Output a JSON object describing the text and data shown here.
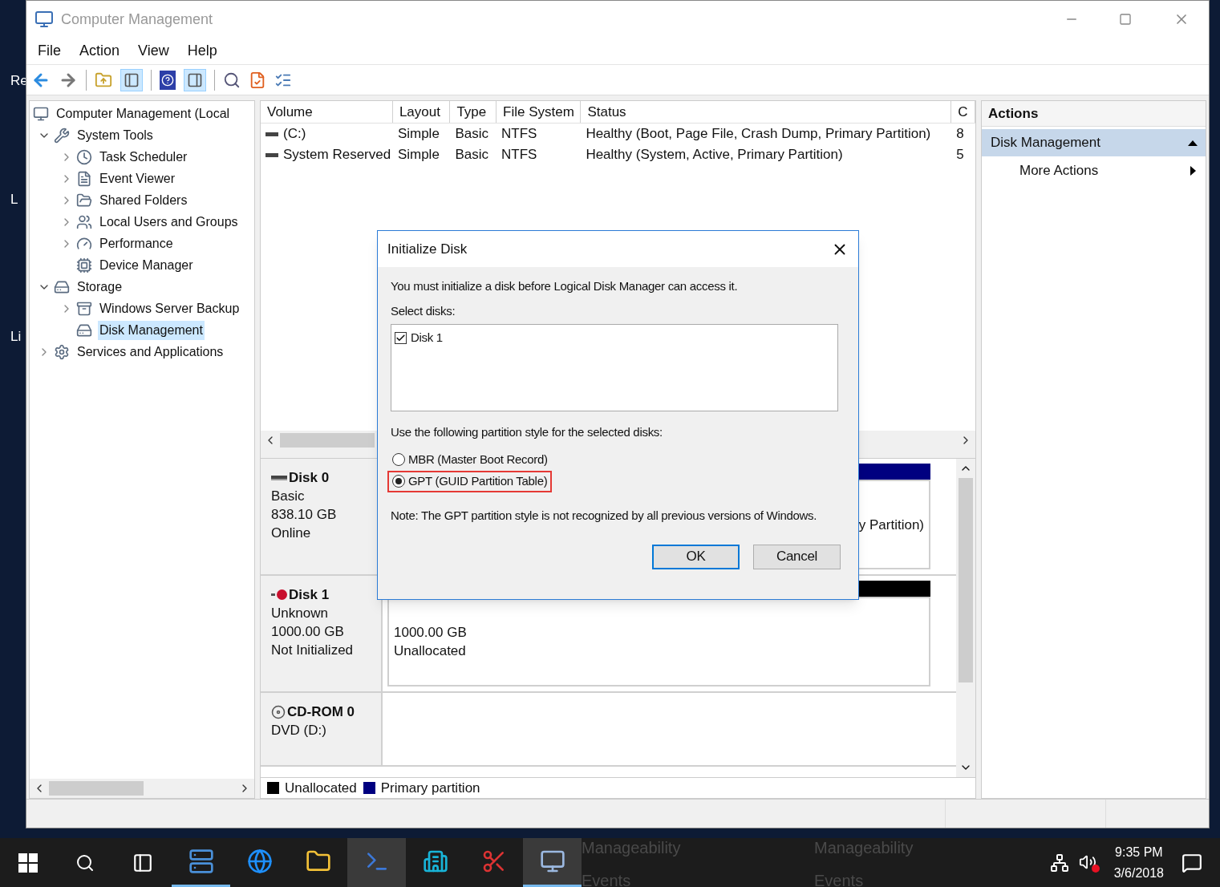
{
  "desktop_fragments": [
    "Re",
    "L",
    "Li"
  ],
  "window": {
    "title": "Computer Management"
  },
  "menu": [
    "File",
    "Action",
    "View",
    "Help"
  ],
  "tree": [
    {
      "label": "Computer Management (Local",
      "selected": false,
      "children": [
        {
          "label": "System Tools",
          "expanded": true,
          "selected": false,
          "children": [
            {
              "label": "Task Scheduler",
              "expanded": false,
              "selected": false
            },
            {
              "label": "Event Viewer",
              "expanded": false,
              "selected": false
            },
            {
              "label": "Shared Folders",
              "expanded": false,
              "selected": false
            },
            {
              "label": "Local Users and Groups",
              "expanded": false,
              "selected": false
            },
            {
              "label": "Performance",
              "expanded": false,
              "selected": false
            },
            {
              "label": "Device Manager",
              "selected": false
            }
          ]
        },
        {
          "label": "Storage",
          "expanded": true,
          "selected": false,
          "children": [
            {
              "label": "Windows Server Backup",
              "expanded": false,
              "selected": false
            },
            {
              "label": "Disk Management",
              "selected": true
            }
          ]
        },
        {
          "label": "Services and Applications",
          "expanded": false,
          "selected": false
        }
      ]
    }
  ],
  "volumes": {
    "columns": [
      "Volume",
      "Layout",
      "Type",
      "File System",
      "Status",
      "C"
    ],
    "rows": [
      [
        "(C:)",
        "Simple",
        "Basic",
        "NTFS",
        "Healthy (Boot, Page File, Crash Dump, Primary Partition)",
        "8"
      ],
      [
        "System Reserved",
        "Simple",
        "Basic",
        "NTFS",
        "Healthy (System, Active, Primary Partition)",
        "5"
      ]
    ]
  },
  "disks": [
    {
      "name": "Disk 0",
      "kind": "online",
      "lines": [
        "Basic",
        "838.10 GB",
        "Online"
      ],
      "partition": {
        "kind": "primary",
        "lines": [
          "y Partition)"
        ]
      }
    },
    {
      "name": "Disk 1",
      "kind": "error",
      "lines": [
        "Unknown",
        "1000.00 GB",
        "Not Initialized"
      ],
      "partition": {
        "kind": "unallocated",
        "lines": [
          "1000.00 GB",
          "Unallocated"
        ]
      }
    },
    {
      "name": "CD-ROM 0",
      "kind": "cdrom",
      "lines": [
        "DVD (D:)"
      ]
    }
  ],
  "legend": [
    {
      "label": "Unallocated",
      "color": "#000000"
    },
    {
      "label": "Primary partition",
      "color": "#000080"
    }
  ],
  "actions": {
    "title": "Actions",
    "items": [
      {
        "label": "Disk Management",
        "kind": "section",
        "expanded": true
      },
      {
        "label": "More Actions",
        "kind": "submenu"
      }
    ]
  },
  "dialog": {
    "title": "Initialize Disk",
    "intro": "You must initialize a disk before Logical Disk Manager can access it.",
    "select_label": "Select disks:",
    "disks": [
      {
        "label": "Disk 1",
        "checked": true
      }
    ],
    "style_label": "Use the following partition style for the selected disks:",
    "options": [
      {
        "label": "MBR (Master Boot Record)",
        "selected": false,
        "highlighted": false
      },
      {
        "label": "GPT (GUID Partition Table)",
        "selected": true,
        "highlighted": true
      }
    ],
    "note": "Note: The GPT partition style is not recognized by all previous versions of Windows.",
    "buttons": [
      {
        "label": "OK",
        "default": true
      },
      {
        "label": "Cancel",
        "default": false
      }
    ]
  },
  "taskbar": {
    "apps": [
      {
        "running": true,
        "selected": false
      },
      {
        "running": false,
        "selected": false
      },
      {
        "running": false,
        "selected": false
      },
      {
        "running": false,
        "selected": true
      },
      {
        "running": false,
        "selected": false
      },
      {
        "running": false,
        "selected": false
      },
      {
        "running": true,
        "selected": true
      }
    ],
    "behind_texts": [
      "Manageability",
      "Events",
      "Manageability",
      "Events"
    ],
    "time": "9:35 PM",
    "date": "3/6/2018"
  }
}
